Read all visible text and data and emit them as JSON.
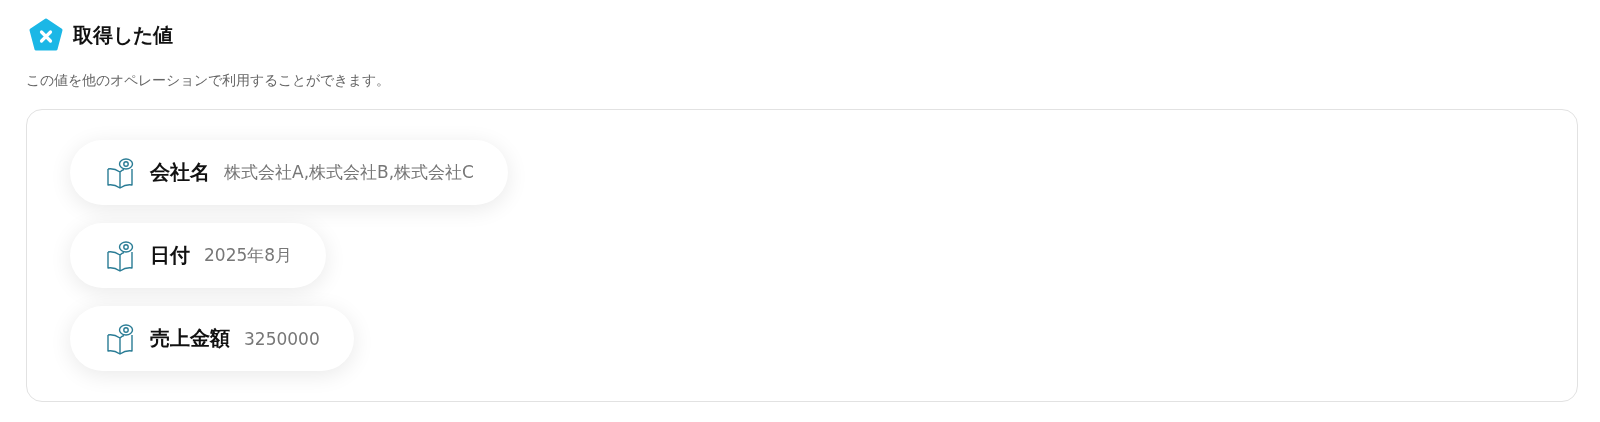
{
  "header": {
    "title": "取得した値",
    "description": "この値を他のオペレーションで利用することができます。"
  },
  "values": [
    {
      "label": "会社名",
      "value": "株式会社A,株式会社B,株式会社C"
    },
    {
      "label": "日付",
      "value": "2025年8月"
    },
    {
      "label": "売上金額",
      "value": "3250000"
    }
  ]
}
